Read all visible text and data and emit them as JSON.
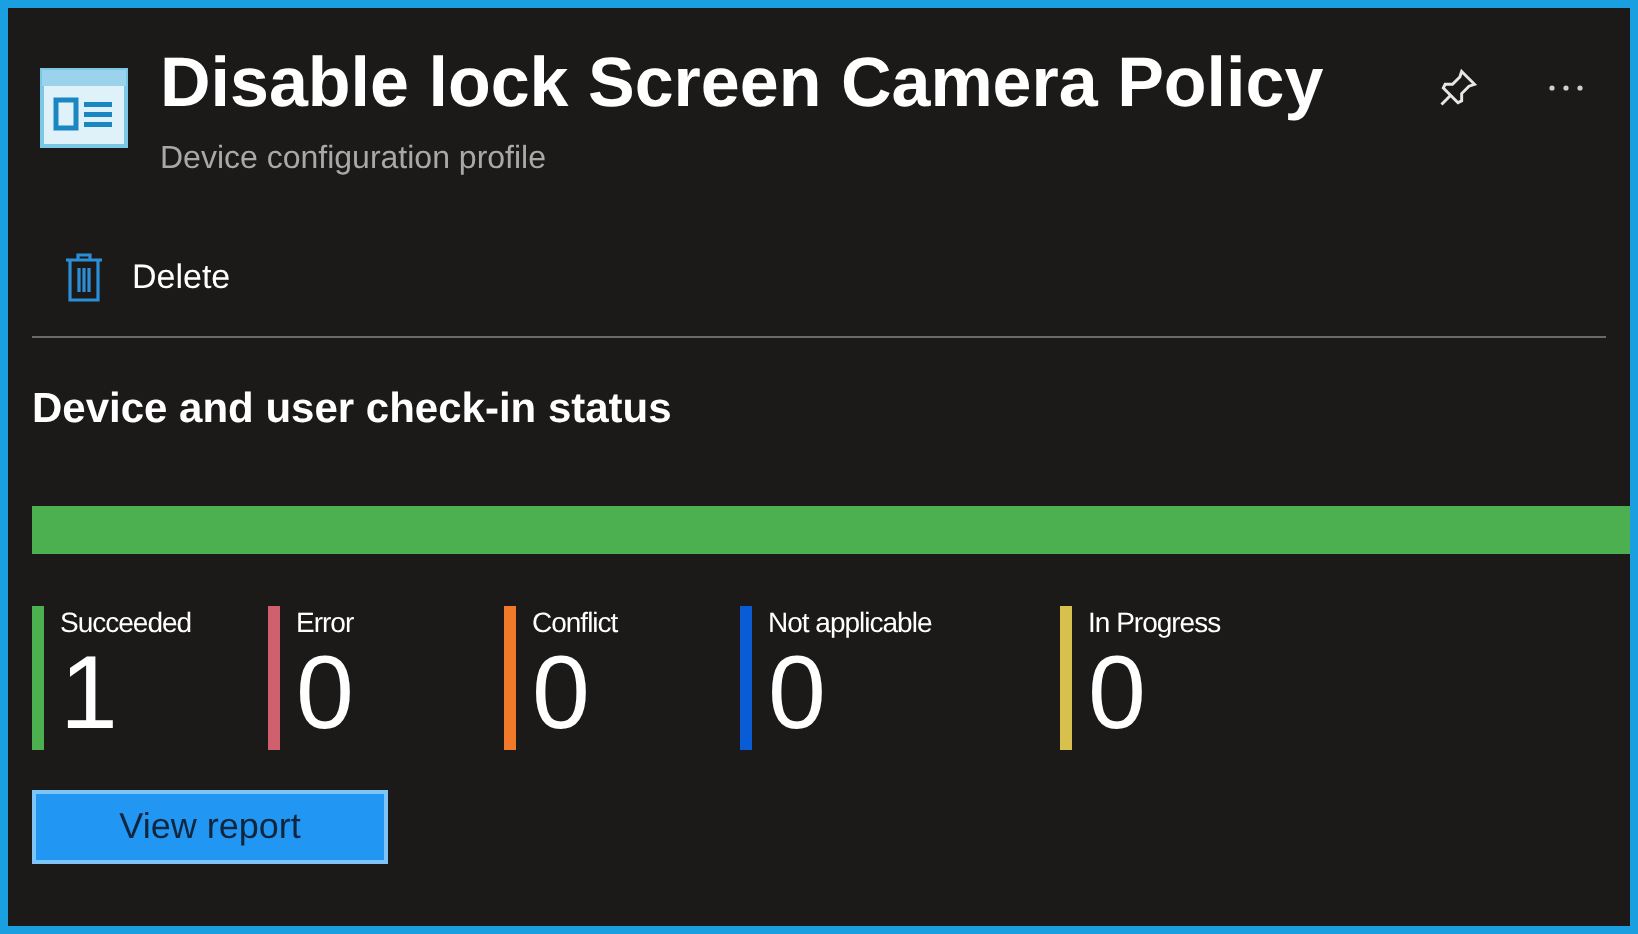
{
  "header": {
    "title": "Disable lock Screen Camera Policy",
    "subtitle": "Device configuration profile"
  },
  "toolbar": [
    {
      "label": "Delete"
    }
  ],
  "check_in_status": {
    "title": "Device and user check-in status",
    "level": 1,
    "stats": [
      {
        "label": "Succeeded",
        "count": "1",
        "color": "#4caf50"
      },
      {
        "label": "Error",
        "count": "0",
        "color": "#d0606e"
      },
      {
        "label": "Conflict",
        "count": "0",
        "color": "#f07a2a"
      },
      {
        "label": "Not applicable",
        "count": "0",
        "color": "#0a5bd6"
      },
      {
        "label": "In Progress",
        "count": "0",
        "color": "#d8c04e"
      }
    ]
  },
  "action": {
    "label": "View report"
  }
}
